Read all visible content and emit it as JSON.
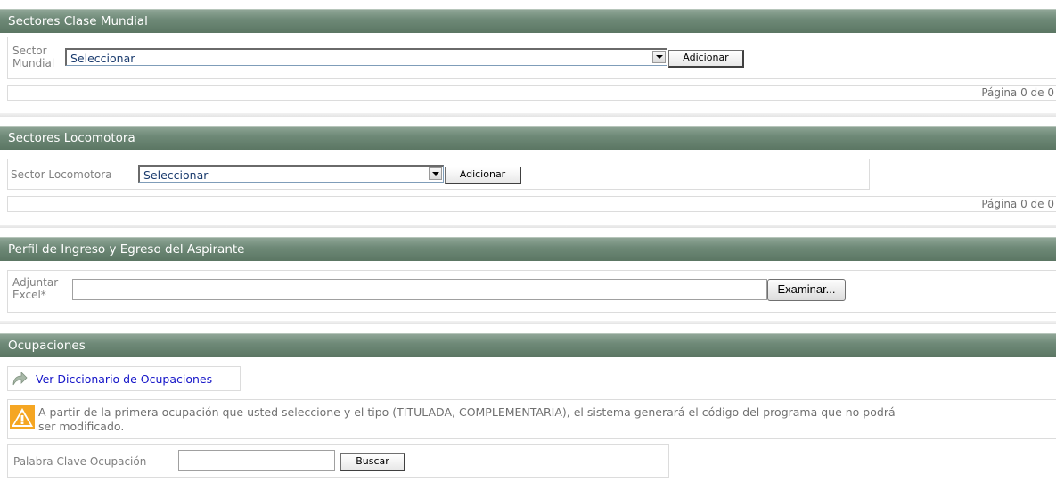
{
  "sectores_mundial": {
    "title": "Sectores Clase Mundial",
    "label_line1": "Sector",
    "label_line2": "Mundial",
    "select_value": "Seleccionar",
    "add_button": "Adicionar",
    "pager": "Página 0 de 0"
  },
  "sectores_locomotora": {
    "title": "Sectores Locomotora",
    "label": "Sector Locomotora",
    "select_value": "Seleccionar",
    "add_button": "Adicionar",
    "pager": "Página 0 de 0"
  },
  "perfil": {
    "title": "Perfil de Ingreso y Egreso del Aspirante",
    "label_line1": "Adjuntar",
    "label_line2": "Excel*",
    "file_value": "",
    "browse_button": "Examinar..."
  },
  "ocupaciones": {
    "title": "Ocupaciones",
    "dictionary_link": "Ver Diccionario de Ocupaciones",
    "warning_line1": "A partir de la primera ocupación que usted seleccione y el tipo (TITULADA, COMPLEMENTARIA), el sistema generará el código del programa que no podrá",
    "warning_line2": "ser modificado.",
    "keyword_label": "Palabra Clave Ocupación",
    "keyword_value": "",
    "search_button": "Buscar"
  },
  "colors": {
    "header_green": "#6f8a78",
    "link_blue": "#1515c8",
    "select_text": "#1a3b6e",
    "warning_orange": "#f0a020"
  }
}
